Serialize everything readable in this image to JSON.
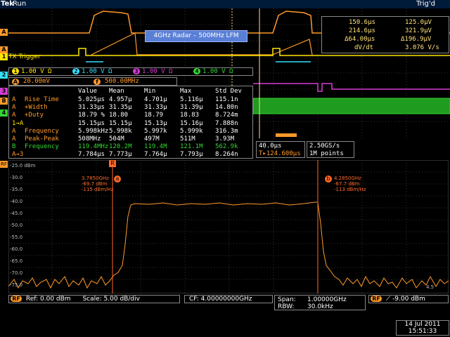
{
  "status": {
    "brand": "Tek",
    "run_state": "Run",
    "trigger_state": "Trig'd"
  },
  "trigger_label": "TX Trigger",
  "overlay_label": "4GHz Radar – 500MHz LFM",
  "cursor_readout": {
    "rows": [
      [
        "150.6µs",
        "125.0µV"
      ],
      [
        "214.6µs",
        "321.9µV"
      ],
      [
        "Δ64.00µs",
        "Δ196.9µV"
      ],
      [
        "dV/dt",
        "3.076 V/s"
      ]
    ]
  },
  "channels": [
    {
      "num": "1",
      "value": "1.00 V",
      "unit": "Ω",
      "color": "#ffe600"
    },
    {
      "num": "2",
      "value": "1.00 V",
      "unit": "Ω",
      "color": "#33e0ff"
    },
    {
      "num": "3",
      "value": "1.00 V",
      "unit": "Ω",
      "color": "#d43cd4"
    },
    {
      "num": "4",
      "value": "1.00 V",
      "unit": "Ω",
      "color": "#33d633"
    }
  ],
  "math": {
    "scale": "20.00mV",
    "freq": "500.00MHz",
    "color": "#ff9a2a"
  },
  "measurements": {
    "headers": [
      "Value",
      "Mean",
      "Min",
      "Max",
      "Std Dev"
    ],
    "rows": [
      {
        "src": "A",
        "name": "Rise Time",
        "color": "#ff9a2a",
        "vals": [
          "5.025µs",
          "4.957µ",
          "4.701µ",
          "5.116µ",
          "115.1n"
        ]
      },
      {
        "src": "A",
        "name": "+Width",
        "color": "#ff9a2a",
        "vals": [
          "31.33µs",
          "31.35µ",
          "31.33µ",
          "31.39µ",
          "14.80n"
        ]
      },
      {
        "src": "A",
        "name": "+Duty",
        "color": "#ff9a2a",
        "vals": [
          "18.79 %",
          "18.80",
          "18.79",
          "18.83",
          "8.724m"
        ]
      },
      {
        "src": "1→A",
        "name": "",
        "color": "#ffe600",
        "vals": [
          "15.15µs",
          "15.15µ",
          "15.13µ",
          "15.16µ",
          "7.888n"
        ]
      },
      {
        "src": "A",
        "name": "Frequency",
        "color": "#ff9a2a",
        "vals": [
          "5.998kHz",
          "5.998k",
          "5.997k",
          "5.999k",
          "316.3m"
        ]
      },
      {
        "src": "A",
        "name": "Peak-Peak",
        "color": "#ff9a2a",
        "vals": [
          "508MHz",
          "504M",
          "497M",
          "511M",
          "3.93M"
        ]
      },
      {
        "src": "B",
        "name": "Frequency",
        "color": "#33d633",
        "vals": [
          "119.4MHz",
          "120.2M",
          "119.4M",
          "121.1M",
          "562.9k"
        ]
      },
      {
        "src": "A→3",
        "name": "",
        "color": "#ff9a2a",
        "vals": [
          "7.784µs",
          "7.773µ",
          "7.764µ",
          "7.793µ",
          "8.264n"
        ]
      }
    ]
  },
  "timebase": {
    "scale": "40.0µs",
    "position": "124.600µs",
    "sample_rate": "2.50GS/s",
    "record": "1M points"
  },
  "spectrum": {
    "ylabels": [
      "-25.0 dBm",
      "-30.0",
      "-35.0",
      "-40.0",
      "-45.0",
      "-50.0",
      "-55.0",
      "-60.0",
      "-65.0",
      "-70.0",
      "-75.0"
    ],
    "marker_a": {
      "id": "a",
      "lines": [
        "3.7850GHz",
        "-69.7 dBm",
        "-115 dBm/Hz"
      ]
    },
    "marker_b": {
      "id": "b",
      "lines": [
        "4.2850GHz",
        "-67.7 dBm",
        "-113 dBm/Hz"
      ]
    },
    "right_edge_label": "4.5"
  },
  "bottom": {
    "ref": "Ref: 0.00 dBm",
    "scale": "Scale: 5.00 dB/div",
    "cf": "CF: 4.00000000GHz",
    "span": "Span:",
    "span_val": "1.00000GHz",
    "rbw": "RBW:",
    "rbw_val": "30.0kHz",
    "rf_trig": "-9.00 dBm",
    "date": "14 Jul 2011",
    "time": "15:51:33"
  },
  "colors": {
    "ch1": "#ffe600",
    "ch2": "#33e0ff",
    "ch3": "#d43cd4",
    "ch4": "#33d633",
    "math": "#ff9a2a"
  }
}
